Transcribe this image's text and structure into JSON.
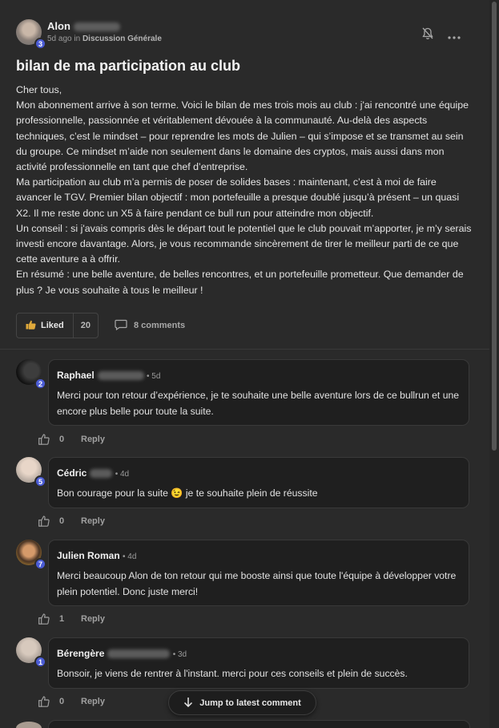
{
  "post": {
    "author_first": "Alon",
    "author_level": "3",
    "time": "5d ago",
    "in_label": "in",
    "category": "Discussion Générale",
    "title": "bilan de ma participation au club",
    "paragraphs": [
      "Cher tous,",
      "Mon abonnement arrive à son terme. Voici le bilan de mes trois mois au club : j'ai rencontré une équipe professionnelle, passionnée et véritablement dévouée à la communauté. Au-delà des aspects techniques, c’est le mindset – pour reprendre les mots de Julien – qui s’impose et se transmet au sein du groupe. Ce mindset m’aide non seulement dans le domaine des cryptos, mais aussi dans mon activité professionnelle en tant que chef d’entreprise.",
      "Ma participation au club m’a permis de poser de solides bases : maintenant, c’est à moi de faire avancer le TGV. Premier bilan objectif : mon portefeuille a presque doublé jusqu’à présent – un quasi X2. Il me reste donc un X5 à faire pendant ce bull run pour atteindre mon objectif.",
      "Un conseil : si j'avais compris dès le départ tout le potentiel que le club pouvait m’apporter, je m’y serais investi encore davantage. Alors, je vous recommande sincèrement de tirer le meilleur parti de ce que cette aventure a à offrir.",
      "En résumé : une belle aventure, de belles rencontres, et un portefeuille prometteur. Que demander de plus ? Je vous souhaite à tous le meilleur !"
    ],
    "liked_label": "Liked",
    "like_count": "20",
    "comments_label": "8 comments"
  },
  "comments": [
    {
      "name": "Raphael",
      "level": "2",
      "time": "• 5d",
      "text": "Merci pour ton retour d’expérience, je te souhaite une belle aventure lors de ce bullrun et une encore plus belle pour toute la suite.",
      "likes": "0",
      "reply": "Reply"
    },
    {
      "name": "Cédric",
      "level": "5",
      "time": "• 4d",
      "text": "Bon courage pour la suite 😉 je te souhaite plein de réussite",
      "likes": "0",
      "reply": "Reply"
    },
    {
      "name": "Julien Roman",
      "level": "7",
      "time": "• 4d",
      "text": "Merci beaucoup Alon de ton retour qui me booste ainsi que toute l'équipe à développer votre plein potentiel. Donc juste merci!",
      "likes": "1",
      "reply": "Reply"
    },
    {
      "name": "Bérengère",
      "level": "1",
      "time": "• 3d",
      "text": "Bonsoir, je viens de rentrer à l'instant. merci pour ces conseils et plein de succès.",
      "likes": "0",
      "reply": "Reply"
    }
  ],
  "jump_label": "Jump to latest comment",
  "icons": {
    "bell": "bell-icon",
    "more": "more-icon",
    "like": "thumbs-up-icon",
    "comment": "comment-icon",
    "arrow": "arrow-down-icon"
  },
  "colors": {
    "background": "#2a2a2a",
    "level_badge": "#4a5bd4"
  }
}
